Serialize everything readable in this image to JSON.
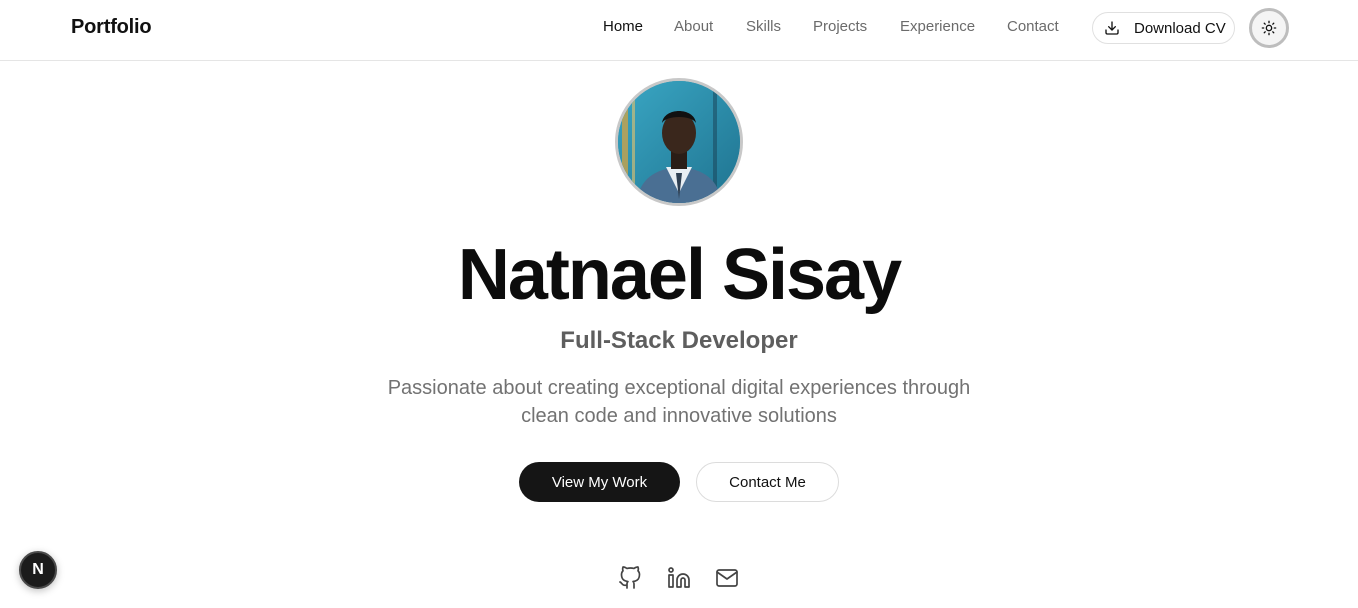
{
  "nav": {
    "brand": "Portfolio",
    "links": [
      "Home",
      "About",
      "Skills",
      "Projects",
      "Experience",
      "Contact"
    ],
    "active_link": "Home",
    "download_cv_label": "Download CV",
    "theme_toggle_icon": "sun-icon"
  },
  "hero": {
    "name": "Natnael Sisay",
    "role": "Full-Stack Developer",
    "tagline": "Passionate about creating exceptional digital experiences through clean code and innovative solutions",
    "primary_button": "View My Work",
    "secondary_button": "Contact Me"
  },
  "social": {
    "icons": [
      "github-icon",
      "linkedin-icon",
      "mail-icon"
    ]
  },
  "dev_badge": {
    "letter": "N"
  },
  "colors": {
    "accent": "#151515",
    "muted_text": "#727272",
    "border": "#e5e5e5"
  }
}
